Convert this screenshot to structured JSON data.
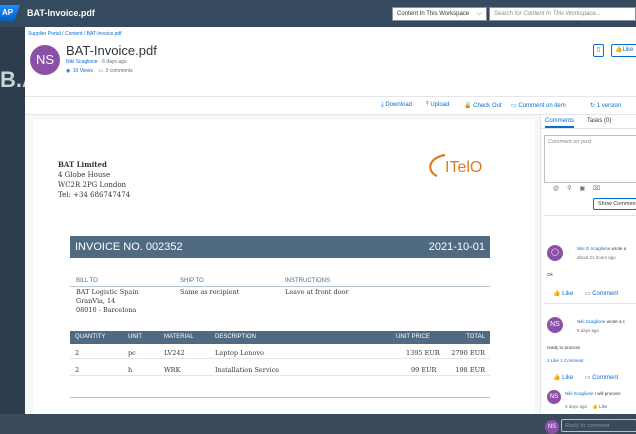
{
  "app": {
    "title": "BAT-Invoice.pdf",
    "sap_logo": "AP"
  },
  "search": {
    "scope": "Content In This Workspace",
    "placeholder": "Search for Content In This Workspace..."
  },
  "background": {
    "ghost_text": "B.A"
  },
  "breadcrumb": "Supplier Portal / Content / BAT-Invoice.pdf",
  "doc": {
    "avatar_initials": "NS",
    "title": "BAT-Invoice.pdf",
    "author": "Niki Scaglione",
    "age": "6 days ago",
    "views": "10 Views",
    "comments": "3 comments"
  },
  "header_buttons": {
    "like": "Like"
  },
  "toolbar": {
    "download": "Download",
    "upload": "Upload",
    "checkout": "Check Out",
    "comment_on_item": "Comment on item",
    "version": "1 version"
  },
  "invoice": {
    "sender": [
      "BAT Limited",
      "4 Globe House",
      "WC2R 2PG London",
      "Tel: +34 686747474"
    ],
    "logo_text": "ITelO",
    "number": "INVOICE NO. 002352",
    "date": "2021-10-01",
    "bill_to_label": "BILL TO",
    "ship_to_label": "SHIP TO",
    "instructions_label": "INSTRUCTIONS",
    "bill_to": [
      "BAT Logistic Spain",
      "GranVia, 14",
      "08010 - Barcelona"
    ],
    "ship_to": "Same as recipient",
    "instructions": "Leave at front door",
    "columns": [
      "QUANTITY",
      "UNIT",
      "MATERIAL",
      "DESCRIPTION",
      "UNIT PRICE",
      "TOTAL"
    ],
    "rows": [
      {
        "qty": "2",
        "unit": "pc",
        "material": "LV242",
        "description": "Laptop Lenovo",
        "price": "1395 EUR",
        "total": "2790 EUR"
      },
      {
        "qty": "2",
        "unit": "h",
        "material": "WRK",
        "description": "Installation Service",
        "price": "99 EUR",
        "total": "198 EUR"
      }
    ]
  },
  "sidebar": {
    "tabs": [
      "Comments",
      "Tasks (0)"
    ],
    "comment_placeholder": "Comment on post",
    "show_button": "Show Comments",
    "comments": [
      {
        "author": "Niki G Scaglione",
        "action": "wrote a",
        "time": "about 21 hours ago",
        "body": "Ok",
        "like": "Like",
        "comment": "Comment"
      },
      {
        "initials": "NS",
        "author": "Niki Scaglione",
        "action": "wrote a c",
        "time": "6 days ago",
        "body": "ready to process",
        "stats": "1 Like 1 Comment",
        "like": "Like",
        "comment": "Comment"
      }
    ],
    "reply": {
      "initials": "NS",
      "author": "Niki Scaglione",
      "text": "I will process",
      "time": "5 days ago",
      "like": "Like"
    },
    "reply_placeholder": "Reply to comment",
    "me_initials": "NS"
  },
  "colors": {
    "shell": "#354a5f",
    "accent": "#0a6ed1",
    "avatar": "#8b51a6",
    "invoice_band": "#506a82",
    "logo": "#e07b20"
  }
}
